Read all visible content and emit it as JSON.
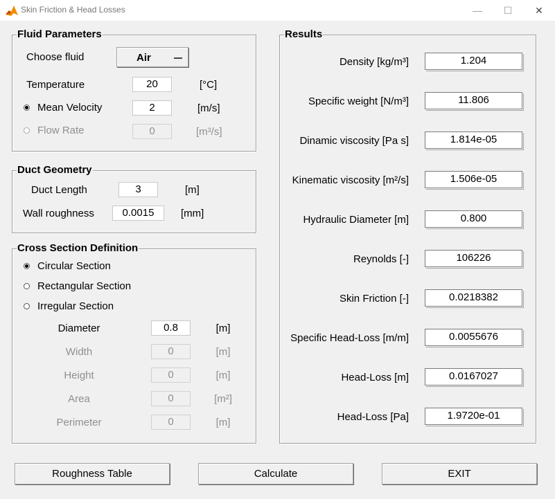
{
  "window": {
    "title": "Skin Friction & Head Losses",
    "minimize": "—",
    "maximize": "☐",
    "close": "✕"
  },
  "fluid": {
    "title": "Fluid Parameters",
    "choose_label": "Choose fluid",
    "fluid_selected": "Air",
    "temperature_label": "Temperature",
    "temperature_value": "20",
    "temperature_unit": "[°C]",
    "velocity_label": "Mean Velocity",
    "velocity_value": "2",
    "velocity_unit": "[m/s]",
    "flowrate_label": "Flow Rate",
    "flowrate_value": "0",
    "flowrate_unit": "[m³/s]"
  },
  "duct": {
    "title": "Duct Geometry",
    "length_label": "Duct Length",
    "length_value": "3",
    "length_unit": "[m]",
    "roughness_label": "Wall roughness",
    "roughness_value": "0.0015",
    "roughness_unit": "[mm]"
  },
  "section": {
    "title": "Cross Section Definition",
    "circular_label": "Circular Section",
    "rectangular_label": "Rectangular Section",
    "irregular_label": "Irregular Section",
    "selected": "circular",
    "diameter_label": "Diameter",
    "diameter_value": "0.8",
    "diameter_unit": "[m]",
    "width_label": "Width",
    "width_value": "0",
    "width_unit": "[m]",
    "height_label": "Height",
    "height_value": "0",
    "height_unit": "[m]",
    "area_label": "Area",
    "area_value": "0",
    "area_unit": "[m²]",
    "perimeter_label": "Perimeter",
    "perimeter_value": "0",
    "perimeter_unit": "[m]"
  },
  "results": {
    "title": "Results",
    "rows": [
      {
        "label": "Density [kg/m³]",
        "value": "1.204"
      },
      {
        "label": "Specific weight [N/m³]",
        "value": "11.806"
      },
      {
        "label": "Dinamic viscosity [Pa s]",
        "value": "1.814e-05"
      },
      {
        "label": "Kinematic viscosity [m²/s]",
        "value": "1.506e-05"
      },
      {
        "label": "Hydraulic Diameter [m]",
        "value": "0.800"
      },
      {
        "label": "Reynolds [-]",
        "value": "106226"
      },
      {
        "label": "Skin Friction [-]",
        "value": "0.0218382"
      },
      {
        "label": "Specific Head-Loss [m/m]",
        "value": "0.0055676"
      },
      {
        "label": "Head-Loss [m]",
        "value": "0.0167027"
      },
      {
        "label": "Head-Loss [Pa]",
        "value": "1.9720e-01"
      }
    ]
  },
  "buttons": {
    "roughness_table": "Roughness Table",
    "calculate": "Calculate",
    "exit": "EXIT"
  },
  "colors": {
    "window_bg": "#f0f0f0",
    "disabled_text": "#8f8f8f",
    "field_bg": "#ffffff",
    "icon_orange": "#f08c00"
  }
}
